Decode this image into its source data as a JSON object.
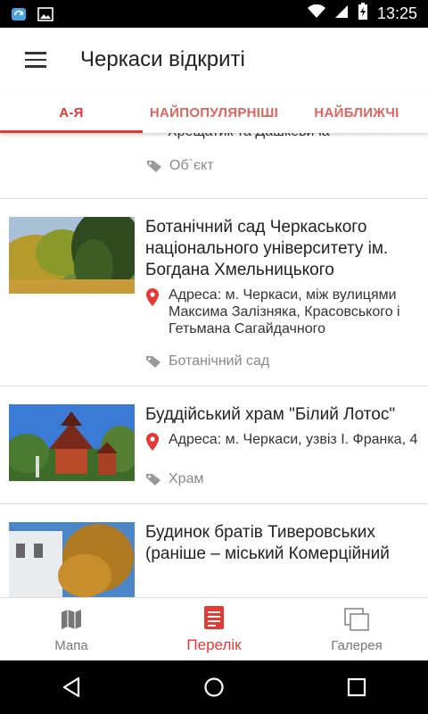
{
  "status_bar": {
    "time": "13:25",
    "left_icons": [
      "sync-app-icon",
      "image-icon"
    ],
    "right_icons": [
      "wifi-icon",
      "signal-icon",
      "battery-charging-icon"
    ]
  },
  "app_bar": {
    "title": "Черкаси відкриті",
    "menu_icon": "hamburger-menu-icon"
  },
  "tabs": [
    {
      "label": "А-Я",
      "active": true
    },
    {
      "label": "НАЙПОПУЛЯРНІШІ",
      "active": false
    },
    {
      "label": "НАЙБЛИЖЧІ",
      "active": false
    }
  ],
  "list": {
    "partial_item": {
      "address_tail": "Хрещатик та Дашкевича",
      "tag": "Об`єкт"
    },
    "items": [
      {
        "title": "Ботанічний сад Черкаського національного університету ім. Богдана Хмельницького",
        "address": "Адреса: м. Черкаси, між вулицями Максима Залізняка, Красовського і Гетьмана Сагайдачного",
        "tag": "Ботанічний сад"
      },
      {
        "title": "Буддійський храм \"Білий Лотос\"",
        "address": "Адреса: м. Черкаси, узвіз І. Франка, 4",
        "tag": "Храм"
      },
      {
        "title": "Будинок братів Тиверовських (раніше – міський Комерційний",
        "address": "",
        "tag": ""
      }
    ]
  },
  "bottom_nav": [
    {
      "label": "Мапа",
      "icon": "map-icon",
      "active": false
    },
    {
      "label": "Перелік",
      "icon": "list-icon",
      "active": true
    },
    {
      "label": "Галерея",
      "icon": "gallery-icon",
      "active": false
    }
  ],
  "system_nav": [
    "back-icon",
    "home-icon",
    "recents-icon"
  ],
  "colors": {
    "accent": "#e53935",
    "tab_inactive": "#e0645f",
    "text": "#222222",
    "muted": "#888888"
  }
}
